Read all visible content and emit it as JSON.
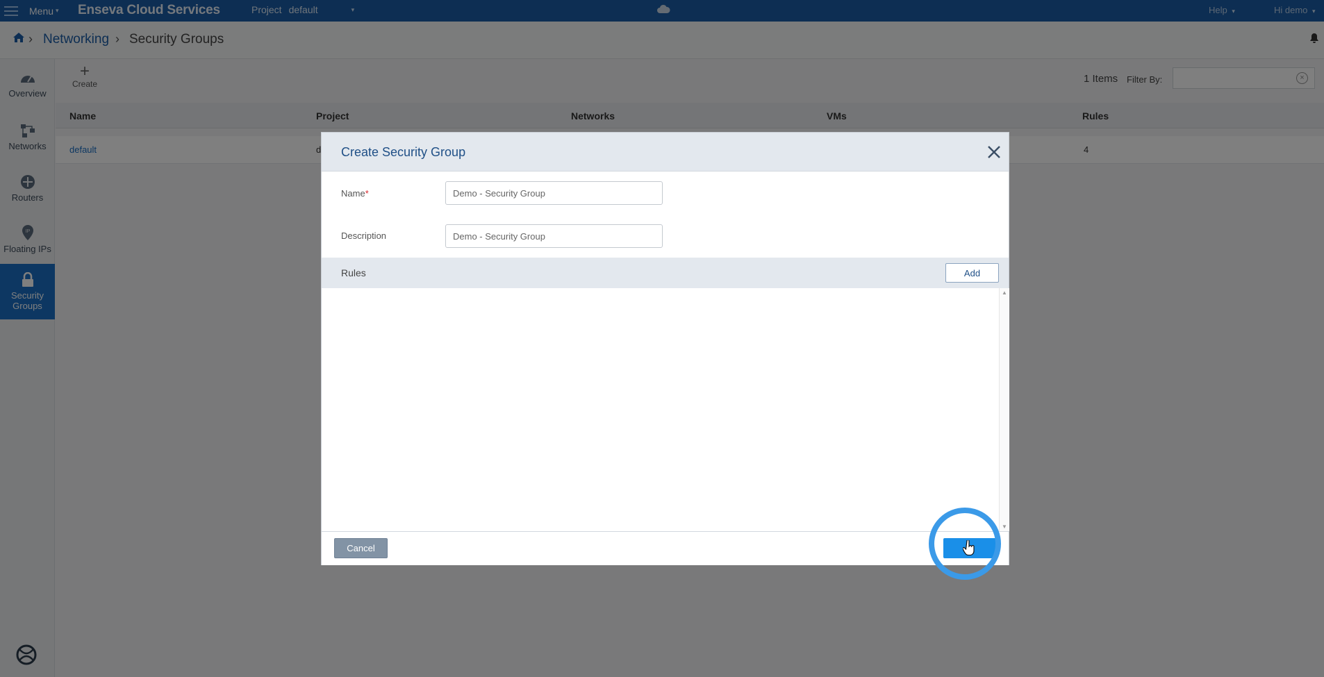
{
  "topbar": {
    "menu_label": "Menu",
    "brand": "Enseva Cloud Services",
    "project_label": "Project",
    "project_value": "default",
    "help_label": "Help",
    "user_label": "Hi demo"
  },
  "breadcrumb": {
    "items": [
      "Networking",
      "Security Groups"
    ]
  },
  "sidebar": {
    "items": [
      {
        "label": "Overview"
      },
      {
        "label": "Networks"
      },
      {
        "label": "Routers"
      },
      {
        "label": "Floating IPs"
      },
      {
        "label": "Security Groups",
        "active": true
      }
    ]
  },
  "toolbar": {
    "create_label": "Create",
    "items_count": "1 Items",
    "filter_label": "Filter By:",
    "filter_value": ""
  },
  "table": {
    "columns": [
      "Name",
      "Project",
      "Networks",
      "VMs",
      "Rules"
    ],
    "rows": [
      {
        "name": "default",
        "project": "d",
        "networks": "",
        "vms": "",
        "rules": "4"
      }
    ]
  },
  "modal": {
    "title": "Create Security Group",
    "name_label": "Name",
    "name_value": "Demo - Security Group",
    "description_label": "Description",
    "description_value": "Demo - Security Group",
    "rules_label": "Rules",
    "add_label": "Add",
    "cancel_label": "Cancel",
    "save_label": ""
  },
  "colors": {
    "topbar": "#1a5da6",
    "active_sidebar": "#1a6fc4",
    "primary_button": "#1a8fe8",
    "click_ring": "#3b9ae8"
  }
}
